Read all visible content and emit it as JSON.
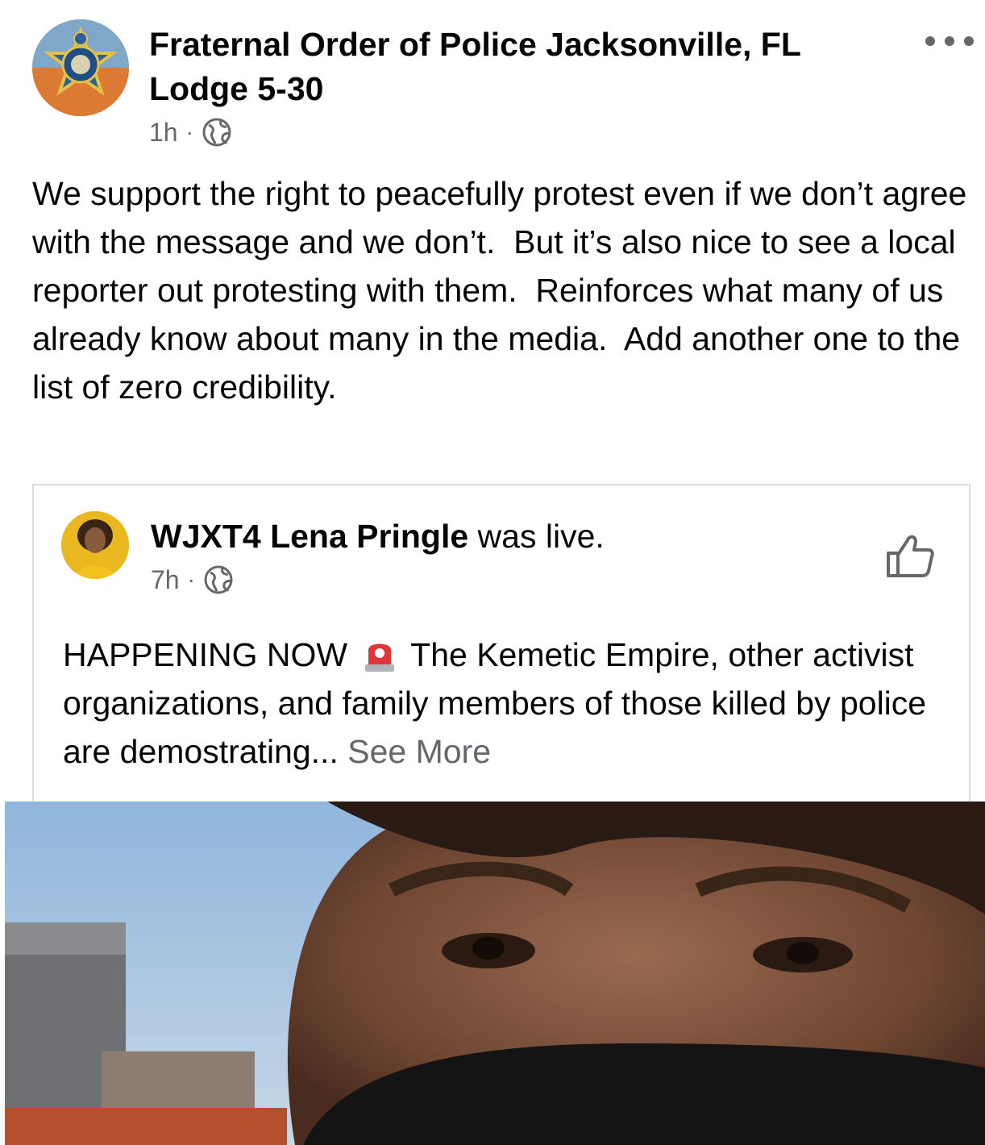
{
  "post": {
    "author": "Fraternal Order of Police Jacksonville, FL Lodge 5-30",
    "time": "1h",
    "dot": "·",
    "globe_icon": "globe-icon",
    "more_icon": "more-options-icon",
    "text": "We support the right to peacefully protest even if we don’t agree with the message and we don’t.  But it’s also nice to see a local reporter out protesting with them.  Reinforces what many of us already know about many in the media.  Add another one to the list of zero credibility."
  },
  "shared": {
    "author": "WJXT4 Lena Pringle",
    "action": " was live.",
    "time": "7h",
    "dot": "·",
    "text_before": "HAPPENING NOW",
    "emoji_icon": "rotating-light-icon",
    "text_after": "The Kemetic Empire, other activist organizations, and family members of those killed by police are demostrating...",
    "see_more": "See More",
    "like_icon": "thumbs-up-icon"
  },
  "colors": {
    "text": "#050505",
    "secondary": "#65676b",
    "border": "#dadde1"
  }
}
